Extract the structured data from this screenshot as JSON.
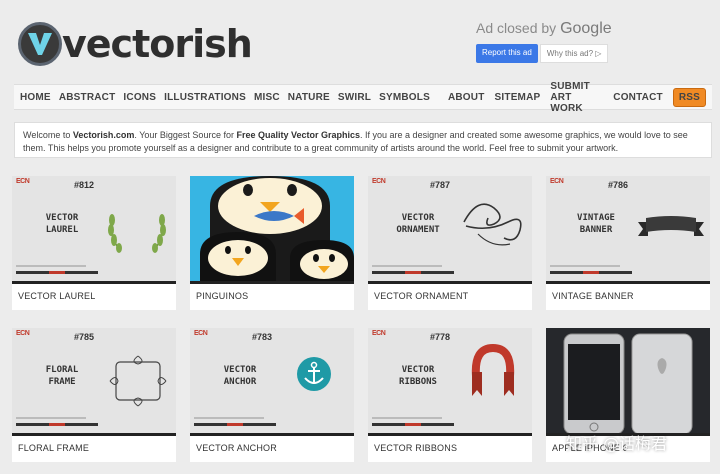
{
  "site": {
    "name": "vectorish"
  },
  "ad": {
    "closed_prefix": "Ad closed by",
    "closed_brand": "Google",
    "report": "Report this ad",
    "why": "Why this ad? ▷"
  },
  "nav": {
    "left": [
      "HOME",
      "ABSTRACT",
      "ICONS",
      "ILLUSTRATIONS",
      "MISC",
      "NATURE",
      "SWIRL",
      "SYMBOLS"
    ],
    "right": [
      "ABOUT",
      "SITEMAP",
      "SUBMIT ART WORK",
      "CONTACT"
    ],
    "rss": "RSS"
  },
  "welcome": {
    "t1": "Welcome to ",
    "b1": "Vectorish.com",
    "t2": ". Your Biggest Source for ",
    "b2": "Free Quality Vector Graphics",
    "t3": ". If you are a designer and created some awesome graphics, we would love to see them. This helps you promote yourself as a designer and contribute to a great community of artists around the world. Feel free to submit your artwork."
  },
  "cards": [
    {
      "label": "VECTOR LAUREL",
      "num": "#812",
      "title": "VECTOR\nLAUREL"
    },
    {
      "label": "PINGUINOS"
    },
    {
      "label": "VECTOR ORNAMENT",
      "num": "#787",
      "title": "VECTOR\nORNAMENT"
    },
    {
      "label": "VINTAGE BANNER",
      "num": "#786",
      "title": "VINTAGE\nBANNER"
    },
    {
      "label": "FLORAL FRAME",
      "num": "#785",
      "title": "FLORAL\nFRAME"
    },
    {
      "label": "VECTOR ANCHOR",
      "num": "#783",
      "title": "VECTOR\nANCHOR"
    },
    {
      "label": "VECTOR RIBBONS",
      "num": "#778",
      "title": "VECTOR\nRIBBONS"
    },
    {
      "label": "APPLE iPHONE 6"
    }
  ],
  "watermark": "知乎 @话梅君",
  "brand_mark": "ECN",
  "colors": {
    "accent": "#3b78e7",
    "rss": "#f08a24",
    "penguin_bg": "#37b5e3"
  }
}
